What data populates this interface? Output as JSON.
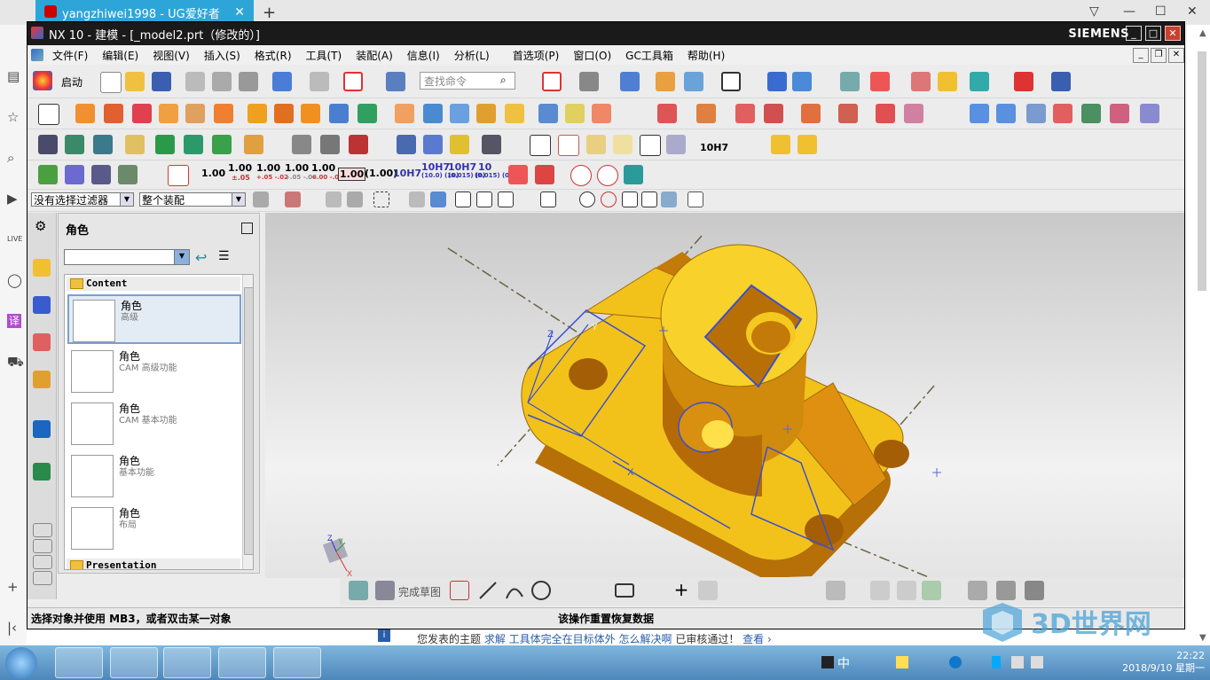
{
  "browser": {
    "tab_title": "yangzhiwei1998 - UG爱好者",
    "tab_close": "✕",
    "new_tab": "+",
    "win_min": "—",
    "win_max": "☐",
    "win_close": "✕",
    "side_live": "LIVE",
    "side_translate": "译",
    "bottom_text_pre": "您发表的主题",
    "bottom_text_link": "求解 工具体完全在目标体外 怎么解决啊",
    "bottom_text_post": "已审核通过！",
    "bottom_view": "查看 ›"
  },
  "nx": {
    "title": "NX 10 - 建模 - [_model2.prt（修改的）]",
    "brand": "SIEMENS",
    "menu": [
      "文件(F)",
      "编辑(E)",
      "视图(V)",
      "插入(S)",
      "格式(R)",
      "工具(T)",
      "装配(A)",
      "信息(I)",
      "分析(L)",
      "首选项(P)",
      "窗口(O)",
      "GC工具箱",
      "帮助(H)"
    ],
    "start_label": "启动",
    "search_placeholder": "查找命令",
    "dim_labels": [
      "1.00",
      "1.00",
      "1.00",
      "1.00",
      "1.00",
      "1.00",
      "(1.00)",
      "10H7",
      "10H7",
      "10H7",
      "10"
    ],
    "dim_sublabels": [
      "±.05",
      "+.05 -.02",
      "+.05 -.00",
      "+.00 -.02",
      "",
      "",
      "",
      "",
      "(10.0) (10)",
      "(0.015) (0)",
      "(0.015) (0)"
    ],
    "tol_label": "10H7",
    "filter_select": "没有选择过滤器",
    "assembly_select": "整个装配",
    "finish_sketch": "完成草图",
    "status_left": "选择对象并使用 MB3，或者双击某一对象",
    "status_right": "该操作重置恢复数据"
  },
  "role_panel": {
    "title": "角色",
    "content_section": "Content",
    "presentation_section": "Presentation",
    "roles": [
      {
        "name": "角色",
        "desc": "高级"
      },
      {
        "name": "角色",
        "desc": "CAM 高级功能"
      },
      {
        "name": "角色",
        "desc": "CAM 基本功能"
      },
      {
        "name": "角色",
        "desc": "基本功能"
      },
      {
        "name": "角色",
        "desc": "布局"
      }
    ]
  },
  "viewport": {
    "axis_z": "Z",
    "axis_y": "Y",
    "axis_x": "X",
    "triad_z": "Z",
    "triad_y": "Y",
    "triad_x": "X"
  },
  "taskbar": {
    "tray_ime": "中",
    "time": "22:22",
    "date": "2018/9/10 星期一"
  },
  "watermark": {
    "brand": "3D世界网",
    "url": "WWW.3DSJW.COM"
  },
  "colors": {
    "part_yellow": "#f2c21b",
    "part_shadow": "#c47a08",
    "edge_blue": "#3a4fd0",
    "title_bar": "#1a1a1a",
    "browser_tab": "#2ea5d8"
  }
}
